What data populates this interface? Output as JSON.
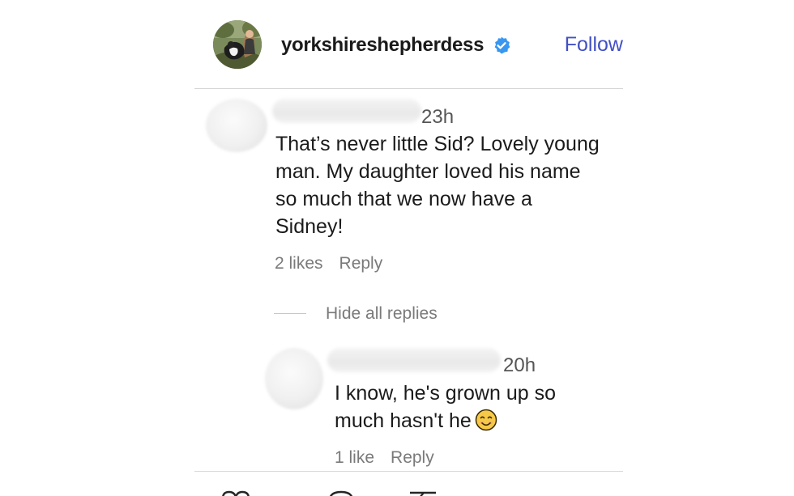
{
  "post": {
    "author": {
      "username": "yorkshireshepherdess",
      "verified_icon": "verified-badge-icon",
      "follow_label": "Follow"
    }
  },
  "comments": [
    {
      "time": "23h",
      "lines": [
        "That’s never little Sid? Lovely young",
        "man. My daughter loved his name",
        "so much that we now have a",
        "Sidney!"
      ],
      "likes": "2 likes",
      "reply_label": "Reply"
    }
  ],
  "thread": {
    "hide_replies_label": "Hide all replies"
  },
  "replies": [
    {
      "time": "20h",
      "lines": [
        "I know, he's grown up so",
        "much hasn't he"
      ],
      "emoji": "smiling-face-icon",
      "likes": "1 like",
      "reply_label": "Reply"
    }
  ],
  "colors": {
    "follow": "#4150c4",
    "verified": "#3897f0",
    "muted_text": "#7a7a7a",
    "divider": "#d6d6d6"
  }
}
